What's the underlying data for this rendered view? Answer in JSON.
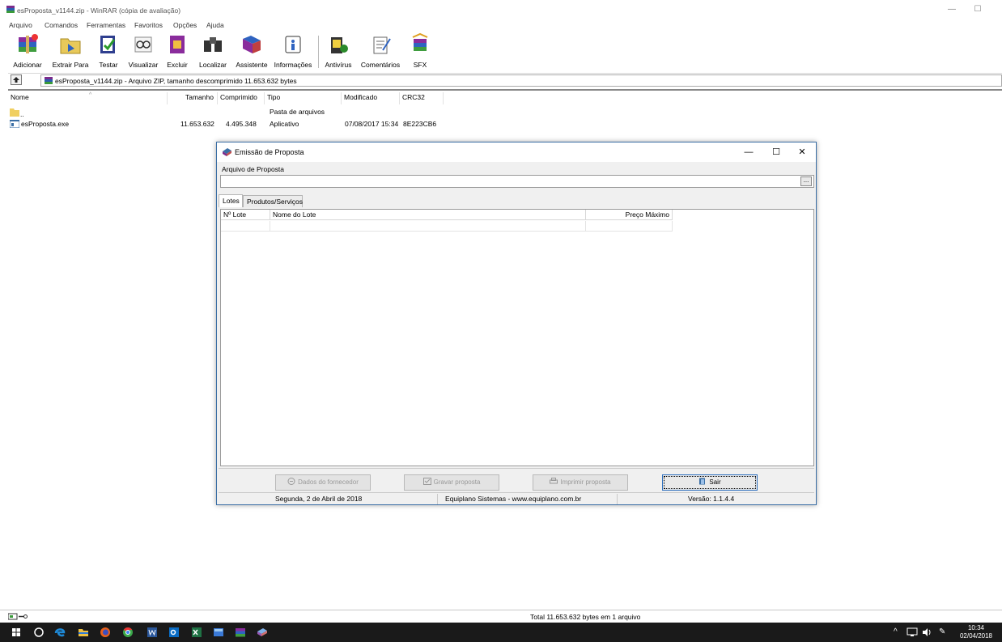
{
  "window": {
    "title": "esProposta_v1144.zip - WinRAR (cópia de avaliação)",
    "minimize": "—",
    "maximize": "☐"
  },
  "menu": [
    "Arquivo",
    "Comandos",
    "Ferramentas",
    "Favoritos",
    "Opções",
    "Ajuda"
  ],
  "toolbar": [
    {
      "label": "Adicionar",
      "icon": "add-books-icon"
    },
    {
      "label": "Extrair Para",
      "icon": "extract-folder-icon"
    },
    {
      "label": "Testar",
      "icon": "test-icon"
    },
    {
      "label": "Visualizar",
      "icon": "view-glasses-icon"
    },
    {
      "label": "Excluir",
      "icon": "delete-icon"
    },
    {
      "label": "Localizar",
      "icon": "find-binoculars-icon"
    },
    {
      "label": "Assistente",
      "icon": "wizard-icon"
    },
    {
      "label": "Informações",
      "icon": "info-icon"
    },
    {
      "label": "Antivírus",
      "icon": "antivirus-icon"
    },
    {
      "label": "Comentários",
      "icon": "comment-icon"
    },
    {
      "label": "SFX",
      "icon": "sfx-icon"
    }
  ],
  "address": {
    "path": "esProposta_v1144.zip - Arquivo ZIP, tamanho descomprimido 11.653.632 bytes"
  },
  "columns": [
    "Nome",
    "Tamanho",
    "Comprimido",
    "Tipo",
    "Modificado",
    "CRC32"
  ],
  "files": [
    {
      "name": "..",
      "size": "",
      "packed": "",
      "type": "Pasta de arquivos",
      "modified": "",
      "crc": "",
      "icon": "folder-icon"
    },
    {
      "name": "esProposta.exe",
      "size": "11.653.632",
      "packed": "4.495.348",
      "type": "Aplicativo",
      "modified": "07/08/2017 15:34",
      "crc": "8E223CB6",
      "icon": "exe-icon"
    }
  ],
  "status": {
    "text": "Total 11.653.632 bytes em 1 arquivo"
  },
  "dialog": {
    "title": "Emissão de Proposta",
    "minimize": "—",
    "maximize": "☐",
    "close": "✕",
    "file_label": "Arquivo de Proposta",
    "file_value": "",
    "browse_label": "...",
    "tabs": [
      "Lotes",
      "Produtos/Serviços"
    ],
    "active_tab": "Lotes",
    "grid_columns": [
      "Nº Lote",
      "Nome do Lote",
      "Preço Máximo"
    ],
    "buttons": [
      {
        "label": "Dados do fornecedor",
        "enabled": false
      },
      {
        "label": "Gravar proposta",
        "enabled": false
      },
      {
        "label": "Imprimir proposta",
        "enabled": false
      },
      {
        "label": "Sair",
        "enabled": true
      }
    ],
    "status": {
      "date": "Segunda, 2 de Abril de 2018",
      "company": "Equiplano Sistemas - www.equiplano.com.br",
      "version": "Versão: 1.1.4.4"
    }
  },
  "taskbar": {
    "clock_time": "10:34",
    "clock_date": "02/04/2018",
    "tray_arrow": "^",
    "tray_pen": "✎"
  }
}
